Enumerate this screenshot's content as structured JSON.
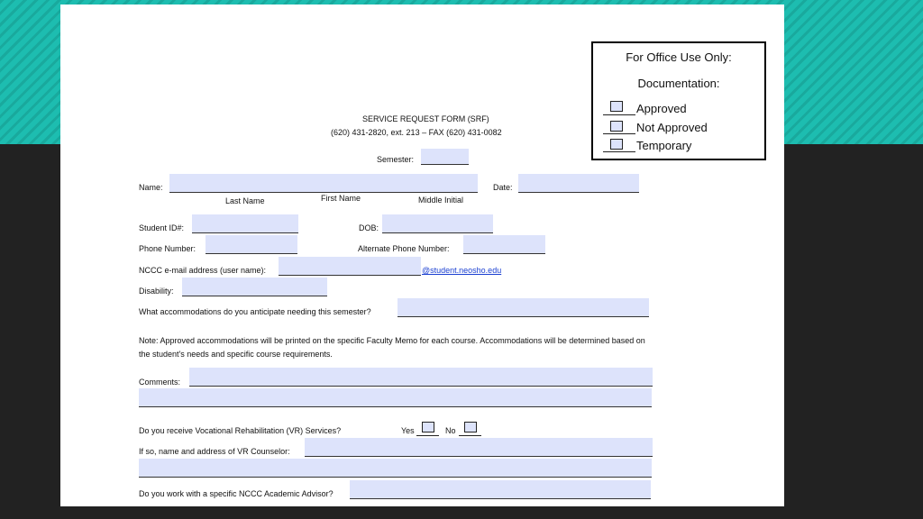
{
  "office": {
    "title": "For Office Use Only:",
    "documentation": "Documentation:",
    "options": [
      "Approved",
      "Not Approved",
      "Temporary"
    ]
  },
  "header": {
    "title": "SERVICE REQUEST FORM (SRF)",
    "phone": "(620) 431-2820, ext. 213 – FAX (620) 431-0082",
    "semester_label": "Semester:"
  },
  "form": {
    "name_label": "Name:",
    "last_name": "Last Name",
    "first_name": "First Name",
    "middle_initial": "Middle Initial",
    "date_label": "Date:",
    "student_id_label": "Student ID#:",
    "dob_label": "DOB:",
    "phone_label": "Phone Number:",
    "alt_phone_label": "Alternate Phone Number:",
    "email_label": "NCCC e-mail address (user name):",
    "email_domain": "@student.neosho.edu",
    "disability_label": "Disability:",
    "accommodations_label": "What accommodations do you anticipate needing this semester?",
    "note_line1": "Note:  Approved accommodations will be printed on the specific Faculty Memo for each course.  Accommodations will be determined based on",
    "note_line2": "the student's needs and specific course requirements.",
    "comments_label": "Comments:",
    "vr_label": "Do you receive Vocational Rehabilitation (VR) Services?",
    "yes": "Yes",
    "no": "No",
    "vr_counselor_label": "If so, name and address of VR Counselor:",
    "advisor_label": "Do you work with a specific NCCC Academic Advisor?"
  }
}
